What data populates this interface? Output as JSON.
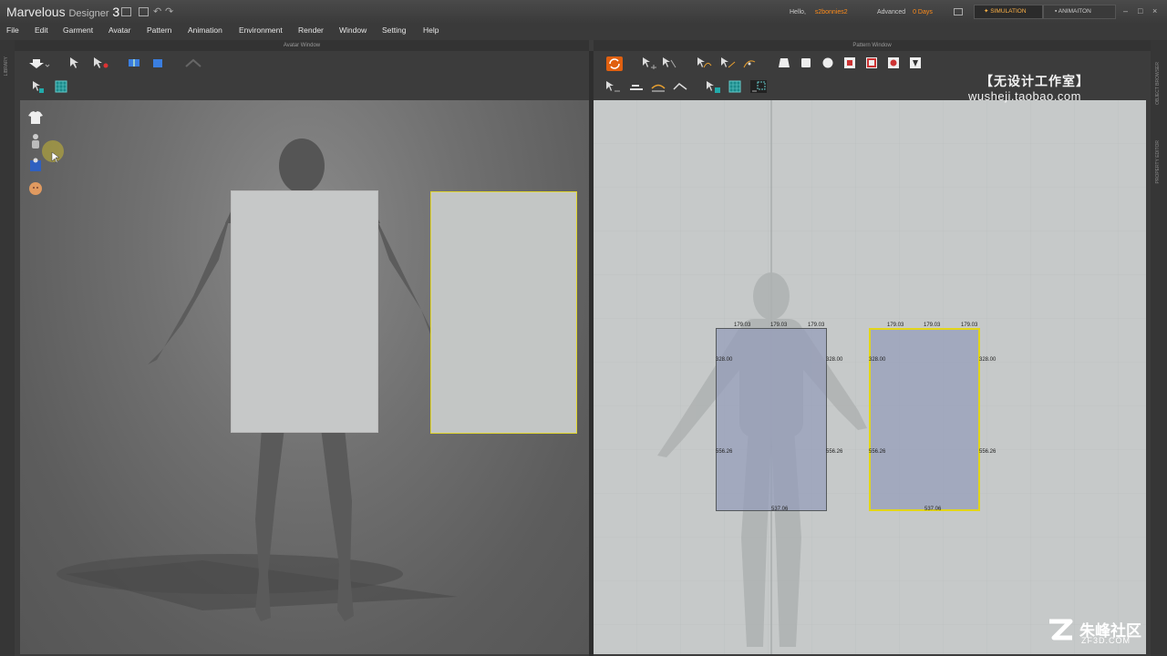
{
  "app": {
    "name": "Marvelous",
    "name_sub": "Designer",
    "version": "3"
  },
  "account": {
    "hello_label": "Hello,",
    "username": "s2bonnies2",
    "edition": "Advanced",
    "days": "0 Days"
  },
  "mode_tabs": {
    "simulation": "SIMULATION",
    "animation": "ANIMAITON",
    "active": "simulation"
  },
  "menu": [
    "File",
    "Edit",
    "Garment",
    "Avatar",
    "Pattern",
    "Animation",
    "Environment",
    "Render",
    "Window",
    "Setting",
    "Help"
  ],
  "panels": {
    "avatar_window": "Avatar Window",
    "pattern_window": "Pattern Window",
    "library": "LIBRARY",
    "object_browser": "OBJECT BROWSER",
    "property_editor": "PROPERTY EDITOR"
  },
  "pattern_pieces": [
    {
      "top": [
        "179.03",
        "179.03",
        "179.03"
      ],
      "left_upper": "328.00",
      "right_upper": "328.00",
      "left_lower": "556.26",
      "right_lower": "556.26",
      "bottom": "537.06",
      "selected": false
    },
    {
      "top": [
        "179.03",
        "179.03",
        "179.03"
      ],
      "left_upper": "328.00",
      "right_upper": "328.00",
      "left_lower": "556.26",
      "right_lower": "556.26",
      "bottom": "537.06",
      "selected": true
    }
  ],
  "watermarks": {
    "studio_cn": "【无设计工作室】",
    "studio_url": "wusheji.taobao.com",
    "community_cn": "朱峰社区",
    "community_url": "ZF3D.COM"
  },
  "colors": {
    "accent_orange": "#ff8c1a",
    "selection_yellow": "#e2d51a",
    "pattern_bg": "#c6c9c9"
  }
}
